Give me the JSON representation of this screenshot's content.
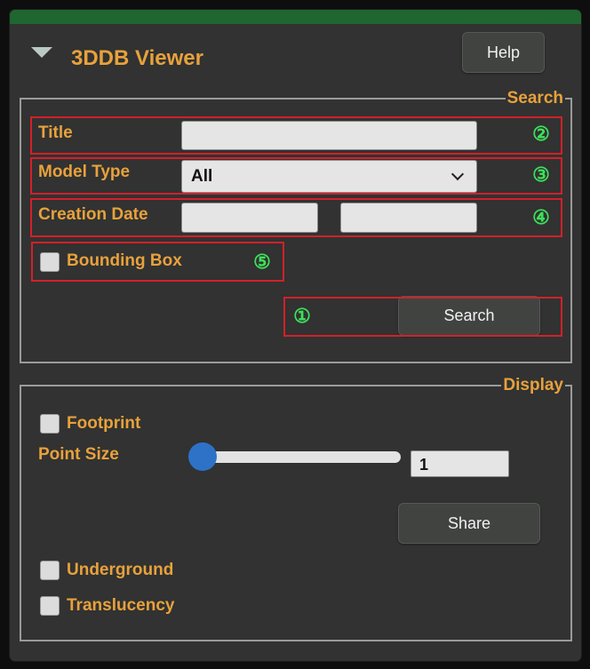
{
  "window": {
    "title": "3DDB Viewer",
    "help_label": "Help",
    "accent": "#e8a13c",
    "topbar_color": "#1f6630"
  },
  "search": {
    "legend": "Search",
    "title_label": "Title",
    "title_value": "",
    "model_type_label": "Model Type",
    "model_type_value": "All",
    "creation_date_label": "Creation Date",
    "date_from_value": "",
    "date_to_value": "",
    "bounding_box_label": "Bounding Box",
    "bounding_box_checked": false,
    "search_label": "Search"
  },
  "markers": {
    "m1": "①",
    "m2": "②",
    "m3": "③",
    "m4": "④",
    "m5": "⑤"
  },
  "display": {
    "legend": "Display",
    "footprint_label": "Footprint",
    "footprint_checked": false,
    "point_size_label": "Point Size",
    "point_size_value": "1",
    "share_label": "Share",
    "underground_label": "Underground",
    "underground_checked": false,
    "translucency_label": "Translucency",
    "translucency_checked": false
  },
  "icons": {
    "collapse": "triangle-down-icon",
    "select": "chevron-down-icon"
  }
}
